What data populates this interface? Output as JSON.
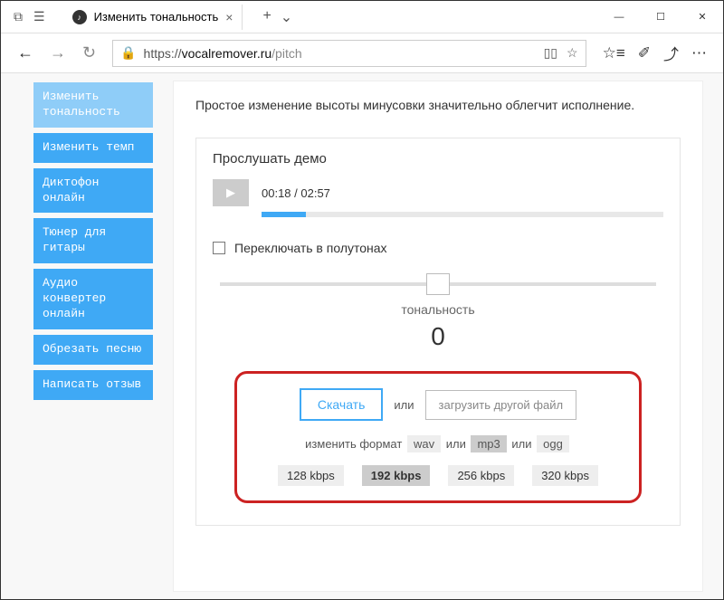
{
  "window": {
    "tab_title": "Изменить тональность"
  },
  "address": {
    "scheme": "https://",
    "host": "vocalremover.ru",
    "path": "/pitch"
  },
  "sidebar": {
    "items": [
      {
        "label": "Изменить тональность"
      },
      {
        "label": "Изменить темп"
      },
      {
        "label": "Диктофон онлайн"
      },
      {
        "label": "Тюнер для гитары"
      },
      {
        "label": "Аудио конвертер онлайн"
      },
      {
        "label": "Обрезать песню"
      },
      {
        "label": "Написать отзыв"
      }
    ]
  },
  "main": {
    "intro": "Простое изменение высоты минусовки значительно облегчит исполнение.",
    "demo_title": "Прослушать демо",
    "time": "00:18 / 02:57",
    "semitones_label": "Переключать в полутонах",
    "tonality_label": "тональность",
    "tonality_value": "0",
    "download": {
      "download_btn": "Скачать",
      "or": "или",
      "upload_btn": "загрузить другой файл",
      "format_label": "изменить формат",
      "formats": {
        "wav": "wav",
        "mp3": "mp3",
        "ogg": "ogg",
        "or": "или"
      },
      "bitrates": [
        "128 kbps",
        "192 kbps",
        "256 kbps",
        "320 kbps"
      ]
    }
  }
}
